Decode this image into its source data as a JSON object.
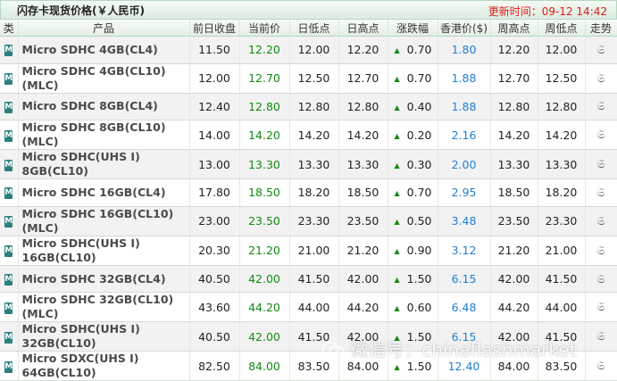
{
  "header": {
    "title": "闪存卡现货价格(￥人民币)",
    "update_label": "更新时间：",
    "update_time": "09-12 14:42"
  },
  "columns": [
    "类",
    "产品",
    "前日收盘",
    "当前价",
    "日低点",
    "日高点",
    "涨跌幅",
    "香港价($)",
    "周高点",
    "周低点",
    "走势"
  ],
  "rows": [
    {
      "product_line1": "Micro SDHC 4GB(CL4)",
      "product_line2": "",
      "prev_close": "11.50",
      "current": "12.20",
      "day_low": "12.00",
      "day_high": "12.20",
      "change": "0.70",
      "hk_price": "1.80",
      "week_high": "12.20",
      "week_low": "12.00"
    },
    {
      "product_line1": "Micro SDHC 4GB(CL10)(MLC)",
      "product_line2": "",
      "prev_close": "12.00",
      "current": "12.70",
      "day_low": "12.50",
      "day_high": "12.70",
      "change": "0.70",
      "hk_price": "1.88",
      "week_high": "12.70",
      "week_low": "12.50"
    },
    {
      "product_line1": "Micro SDHC 8GB(CL4)",
      "product_line2": "",
      "prev_close": "12.40",
      "current": "12.80",
      "day_low": "12.80",
      "day_high": "12.80",
      "change": "0.40",
      "hk_price": "1.88",
      "week_high": "12.80",
      "week_low": "12.80"
    },
    {
      "product_line1": "Micro SDHC 8GB(CL10)(MLC)",
      "product_line2": "",
      "prev_close": "14.00",
      "current": "14.20",
      "day_low": "14.20",
      "day_high": "14.20",
      "change": "0.20",
      "hk_price": "2.16",
      "week_high": "14.20",
      "week_low": "14.20"
    },
    {
      "product_line1": "Micro SDHC(UHS I) 8GB(CL10)",
      "product_line2": "",
      "prev_close": "13.00",
      "current": "13.30",
      "day_low": "13.30",
      "day_high": "13.30",
      "change": "0.30",
      "hk_price": "2.00",
      "week_high": "13.30",
      "week_low": "13.30"
    },
    {
      "product_line1": "Micro SDHC 16GB(CL4)",
      "product_line2": "",
      "prev_close": "17.80",
      "current": "18.50",
      "day_low": "18.20",
      "day_high": "18.50",
      "change": "0.70",
      "hk_price": "2.95",
      "week_high": "18.50",
      "week_low": "18.20"
    },
    {
      "product_line1": "Micro SDHC 16GB(CL10)(MLC)",
      "product_line2": "",
      "prev_close": "23.00",
      "current": "23.50",
      "day_low": "23.30",
      "day_high": "23.50",
      "change": "0.50",
      "hk_price": "3.48",
      "week_high": "23.50",
      "week_low": "23.30"
    },
    {
      "product_line1": "Micro SDHC(UHS I)",
      "product_line2": "16GB(CL10)",
      "prev_close": "20.30",
      "current": "21.20",
      "day_low": "21.00",
      "day_high": "21.20",
      "change": "0.90",
      "hk_price": "3.12",
      "week_high": "21.20",
      "week_low": "21.00"
    },
    {
      "product_line1": "Micro SDHC 32GB(CL4)",
      "product_line2": "",
      "prev_close": "40.50",
      "current": "42.00",
      "day_low": "41.50",
      "day_high": "42.00",
      "change": "1.50",
      "hk_price": "6.15",
      "week_high": "42.00",
      "week_low": "41.50"
    },
    {
      "product_line1": "Micro SDHC 32GB(CL10)(MLC)",
      "product_line2": "",
      "prev_close": "43.60",
      "current": "44.20",
      "day_low": "44.00",
      "day_high": "44.20",
      "change": "0.60",
      "hk_price": "6.48",
      "week_high": "44.20",
      "week_low": "44.00"
    },
    {
      "product_line1": "Micro SDHC(UHS I)",
      "product_line2": "32GB(CL10)",
      "prev_close": "40.50",
      "current": "42.00",
      "day_low": "41.50",
      "day_high": "42.00",
      "change": "1.50",
      "hk_price": "6.15",
      "week_high": "42.00",
      "week_low": "41.50"
    },
    {
      "product_line1": "Micro SDXC(UHS I)",
      "product_line2": "64GB(CL10)",
      "prev_close": "82.50",
      "current": "84.00",
      "day_low": "83.50",
      "day_high": "84.00",
      "change": "1.50",
      "hk_price": "12.40",
      "week_high": "84.00",
      "week_low": "83.50"
    }
  ],
  "icons": {
    "category": "memory-card-icon",
    "change_up": "up-triangle-icon",
    "trend": "trend-chart-icon"
  },
  "colors": {
    "current_price": "#148a14",
    "hk_price": "#1f7fd2",
    "update_time": "#e21a1a",
    "category_icon": "#2a7f7f"
  },
  "watermark": "微信号：chinaflashmarket"
}
